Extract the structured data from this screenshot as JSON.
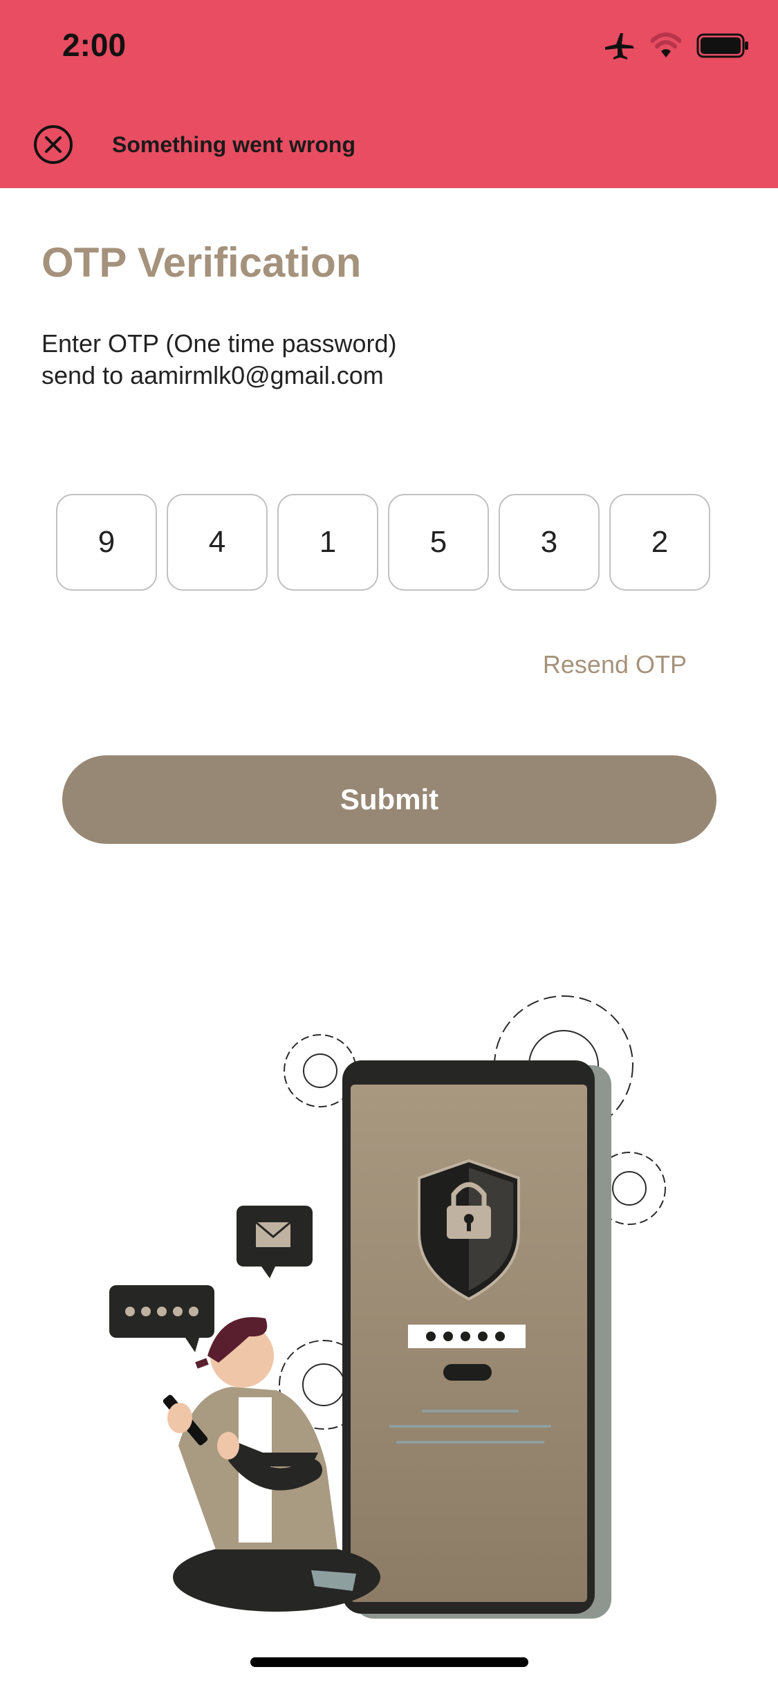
{
  "status_bar": {
    "time": "2:00",
    "icons": [
      "airplane-icon",
      "wifi-icon",
      "battery-icon"
    ]
  },
  "error_banner": {
    "message": "Something went wrong",
    "icon": "close-circle-icon",
    "color": "#e84d62"
  },
  "page": {
    "title": "OTP Verification",
    "subtitle_line1": "Enter OTP (One time password)",
    "subtitle_line2": "send to aamirmlk0@gmail.com"
  },
  "otp": {
    "digits": [
      "9",
      "4",
      "1",
      "5",
      "3",
      "2"
    ]
  },
  "actions": {
    "resend_label": "Resend OTP",
    "submit_label": "Submit"
  },
  "theme": {
    "accent": "#a5927c",
    "button": "#978875"
  }
}
